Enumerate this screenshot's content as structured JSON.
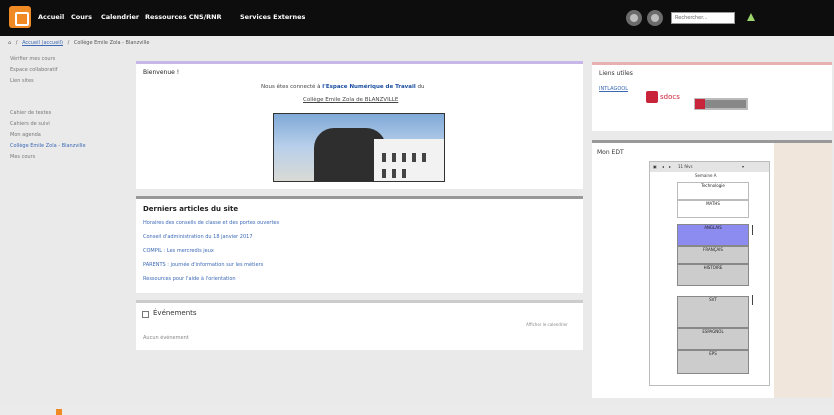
{
  "nav": {
    "items": [
      "Accueil",
      "Cours",
      "Calendrier",
      "Ressources CNS/RNR",
      "Services Externes"
    ],
    "search_placeholder": "Rechercher..."
  },
  "breadcrumb": [
    "Accueil (accueil)",
    "Collège Emile Zola - Blanzville"
  ],
  "sidebar": {
    "items_top": [
      "Vérifier mes cours",
      "Espace collaboratif",
      "Lien sites"
    ],
    "items_bottom": [
      "Cahier de textes",
      "Cahiers de suivi",
      "Mon agenda",
      "Collège Emile Zola - Blanzville",
      "Mes cours"
    ]
  },
  "welcome": {
    "title": "Bienvenue !",
    "line1_prefix": "Nous êtes connecté à",
    "line1_bold": "l'Espace Numérique de Travail",
    "line1_suffix": "du",
    "school_link": "Collège Emile Zola de BLANZVILLE"
  },
  "articles": {
    "title": "Derniers articles du site",
    "items": [
      "Horaires des conseils de classe et des portes ouvertes",
      "Conseil d'administration du 18 janvier 2017",
      "COMPIL : Les mercredis jeux",
      "PARENTS : journée d'information sur les métiers",
      "Ressources pour l'aide à l'orientation"
    ]
  },
  "events": {
    "title": "Événements",
    "more_link": "Afficher le calendrier",
    "empty_text": "Aucun événement"
  },
  "right": {
    "links_title": "Liens utiles",
    "links_item": "INTLAGOOL",
    "sdocs_label": "sdocs",
    "edt_title": "Mon EDT"
  },
  "edt": {
    "toolbar_date": "11 févr.",
    "week_label": "Semaine A",
    "cells": [
      "Technologie",
      "MATHS",
      "ANGLAIS",
      "FRANÇAIS",
      "HISTOIRE",
      "SVT",
      "ESPAGNOL",
      "EPS"
    ]
  }
}
